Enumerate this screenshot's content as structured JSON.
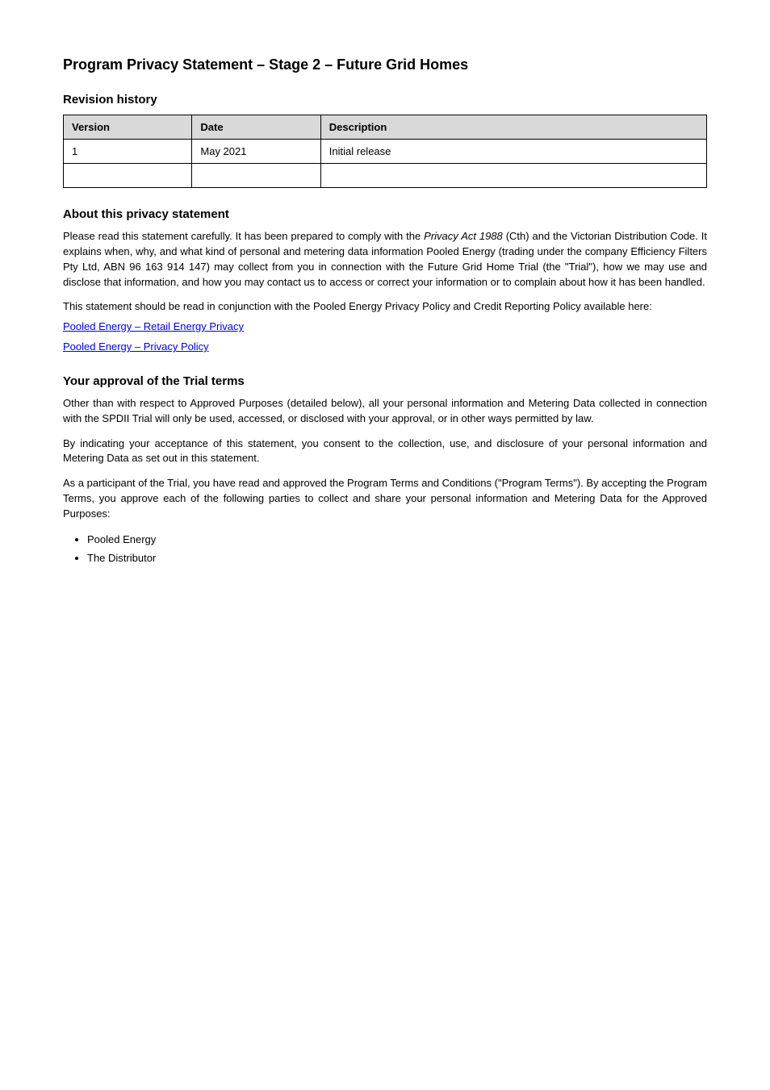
{
  "title": "Program Privacy Statement – Stage 2 – Future Grid Homes",
  "sections": {
    "revhist": {
      "heading": "Revision history",
      "headers": [
        "Version",
        "Date",
        "Description"
      ],
      "rows": [
        {
          "version": "1",
          "date": "May 2021",
          "desc": "Initial release"
        },
        {
          "version": "",
          "date": "",
          "desc": ""
        }
      ]
    },
    "about": {
      "heading": "About this privacy statement",
      "p1_before": "Please read this statement carefully. It has been prepared to comply with the ",
      "p1_em": "Privacy Act 1988",
      "p1_after": " (Cth) and the Victorian Distribution Code. It explains when, why, and what kind of personal and metering data information Pooled Energy (trading under the company Efficiency Filters Pty Ltd, ABN 96 163 914 147) may collect from you in connection with the Future Grid Home Trial (the \"Trial\"), how we may use and disclose that information, and how you may contact us to access or correct your information or to complain about how it has been handled.",
      "p2": "This statement should be read in conjunction with the Pooled Energy Privacy Policy and Credit Reporting Policy available here:",
      "link1_text": "Pooled Energy – Retail Energy Privacy",
      "link1_href": "#",
      "link2_text": "Pooled Energy – Privacy Policy",
      "link2_href": "#"
    },
    "approve": {
      "heading": "Your approval of the Trial terms",
      "p1": "Other than with respect to Approved Purposes (detailed below), all your personal information and Metering Data collected in connection with the SPDII Trial will only be used, accessed, or disclosed with your approval, or in other ways permitted by law.",
      "p2": "By indicating your acceptance of this statement, you consent to the collection, use, and disclosure of your personal information and Metering Data as set out in this statement.",
      "p3": "As a participant of the Trial, you have read and approved the Program Terms and Conditions (\"Program Terms\"). By accepting the Program Terms, you approve each of the following parties to collect and share your personal information and Metering Data for the Approved Purposes:",
      "items": [
        "Pooled Energy",
        "The Distributor"
      ]
    }
  }
}
